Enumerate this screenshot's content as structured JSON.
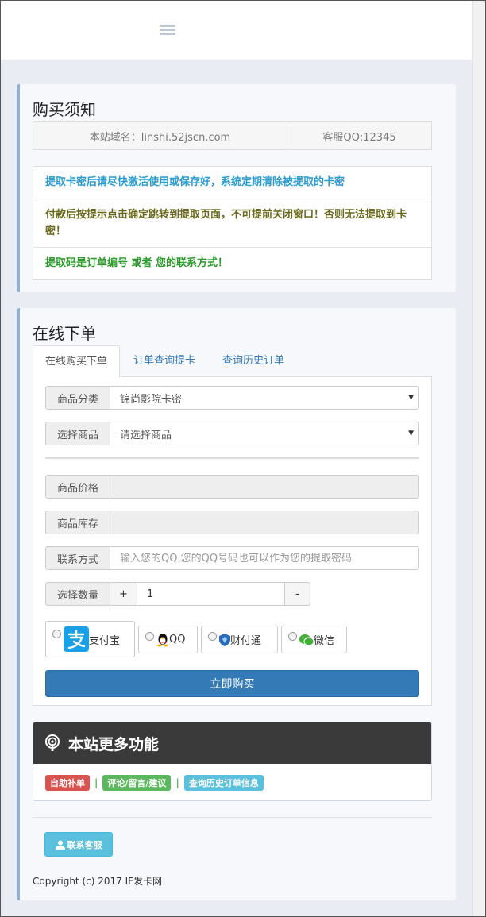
{
  "notice_card": {
    "title": "购买须知",
    "site_domain": "本站域名：linshi.52jscn.com",
    "service_qq": "客服QQ:12345",
    "notices": [
      "提取卡密后请尽快激活使用或保存好，系统定期清除被提取的卡密",
      "付款后按提示点击确定跳转到提取页面，不可提前关闭窗口！否则无法提取到卡密！",
      "提取码是订单编号 或者 您的联系方式！"
    ]
  },
  "order_card": {
    "title": "在线下单",
    "tabs": [
      "在线购买下单",
      "订单查询提卡",
      "查询历史订单"
    ],
    "form": {
      "category_label": "商品分类",
      "category_value": "锦尚影院卡密",
      "product_label": "选择商品",
      "product_value": "请选择商品",
      "price_label": "商品价格",
      "stock_label": "商品库存",
      "contact_label": "联系方式",
      "contact_placeholder": "输入您的QQ,您的QQ号码也可以作为您的提取密码",
      "quantity_label": "选择数量",
      "plus": "+",
      "quantity_value": "1",
      "minus": "-"
    },
    "payment_methods": [
      "支付宝",
      "QQ",
      "财付通",
      "微信"
    ],
    "buy_button": "立即购买",
    "more": {
      "title": "本站更多功能",
      "links": [
        "自助补单",
        "评论/留言/建议",
        "查询历史订单信息"
      ],
      "separator": "|"
    },
    "contact_button": "联系客服",
    "copyright": "Copyright (c) 2017 IF发卡网"
  },
  "colors": {
    "primary": "#337ab7",
    "danger": "#d9534f",
    "success": "#5cb85c",
    "info": "#5bc0de",
    "card_accent": "#8fb1d8"
  }
}
